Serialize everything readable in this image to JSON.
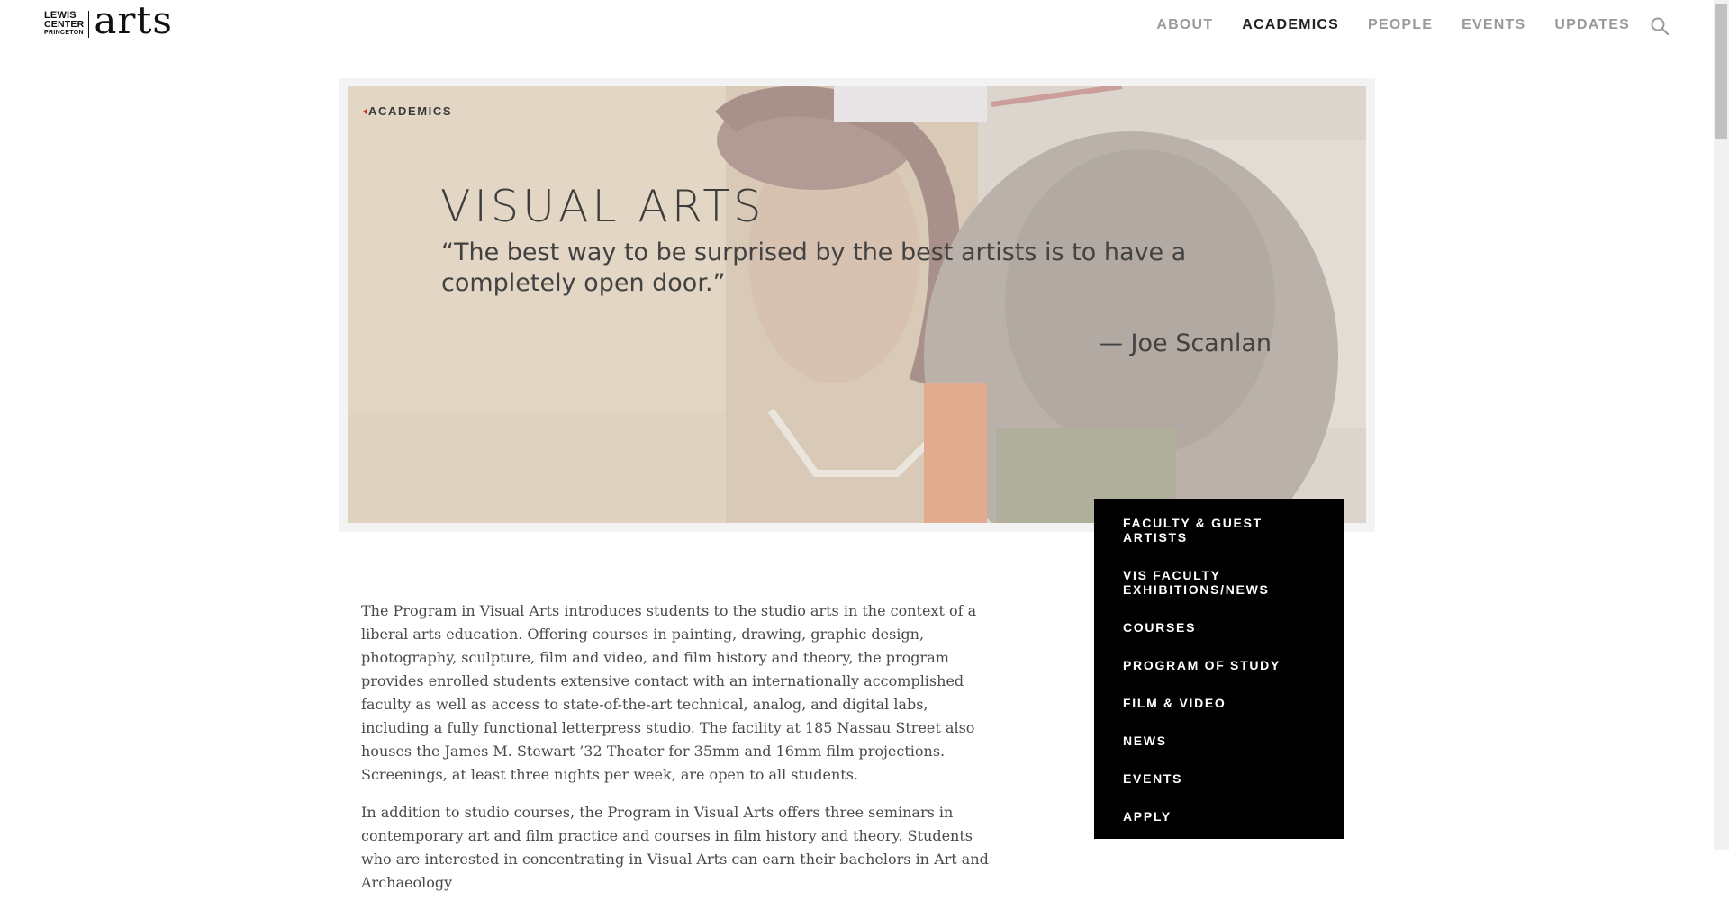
{
  "logo": {
    "line1": "LEWIS",
    "line2": "CENTER",
    "line3": "PRINCETON",
    "wordmark": "arts"
  },
  "nav": {
    "items": [
      "ABOUT",
      "ACADEMICS",
      "PEOPLE",
      "EVENTS",
      "UPDATES"
    ],
    "active": "ACADEMICS",
    "search_icon": "search-icon"
  },
  "hero": {
    "breadcrumb": "ACADEMICS",
    "title": "VISUAL ARTS",
    "quote": "“The best way to be surprised by the best artists is to have a completely open door.”",
    "attribution": "— Joe Scanlan"
  },
  "side_menu": {
    "items": [
      "FACULTY & GUEST ARTISTS",
      "VIS FACULTY EXHIBITIONS/NEWS",
      "COURSES",
      "PROGRAM OF STUDY",
      "FILM & VIDEO",
      "NEWS",
      "EVENTS",
      "APPLY"
    ]
  },
  "body": {
    "paragraph1": "The Program in Visual Arts introduces students to the studio arts in the context of a liberal arts education. Offering courses in painting, drawing, graphic design, photography, sculpture, film and video, and film history and theory, the program provides enrolled students extensive contact with an internationally accomplished faculty as well as access to state-of-the-art technical, analog, and digital labs, including a fully functional letterpress studio. The facility at 185 Nassau Street also houses the James M. Stewart ’32 Theater for 35mm and 16mm film projections. Screenings, at least three nights per week, are open to all students.",
    "paragraph2": "In addition to studio courses, the Program in Visual Arts offers three seminars in contemporary art and film practice and courses in film history and theory. Students who are interested in concentrating in Visual Arts can earn their bachelors in Art and Archaeology"
  },
  "colors": {
    "accent": "#c0392b",
    "menu_bg": "#000000",
    "nav_inactive": "#9a9a9a",
    "nav_active": "#222222"
  }
}
